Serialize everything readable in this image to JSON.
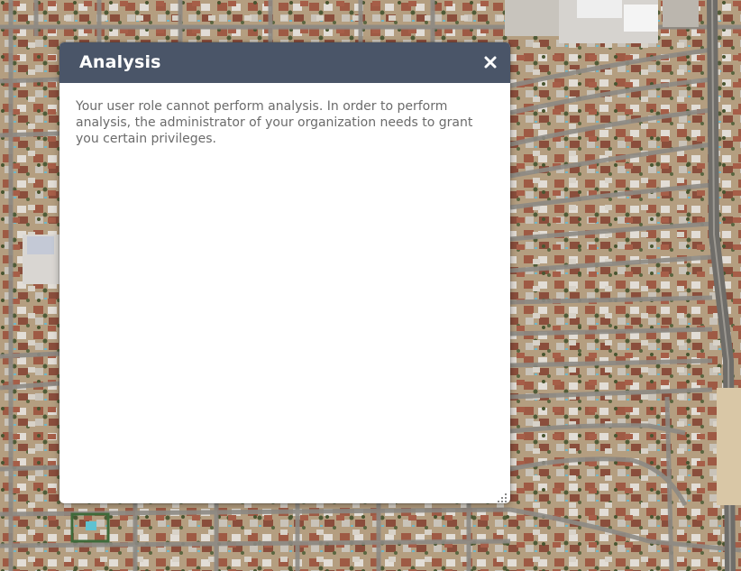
{
  "dialog": {
    "title": "Analysis",
    "message": "Your user role cannot perform analysis. In order to perform analysis, the administrator of your organization needs to grant you certain privileges.",
    "close_icon": "close-icon",
    "resize_icon": "resize-grip-icon"
  },
  "colors": {
    "header_bg": "#4a5568",
    "header_text": "#ffffff",
    "body_text": "#6b6b6b",
    "map_ground": "#b9a486"
  }
}
